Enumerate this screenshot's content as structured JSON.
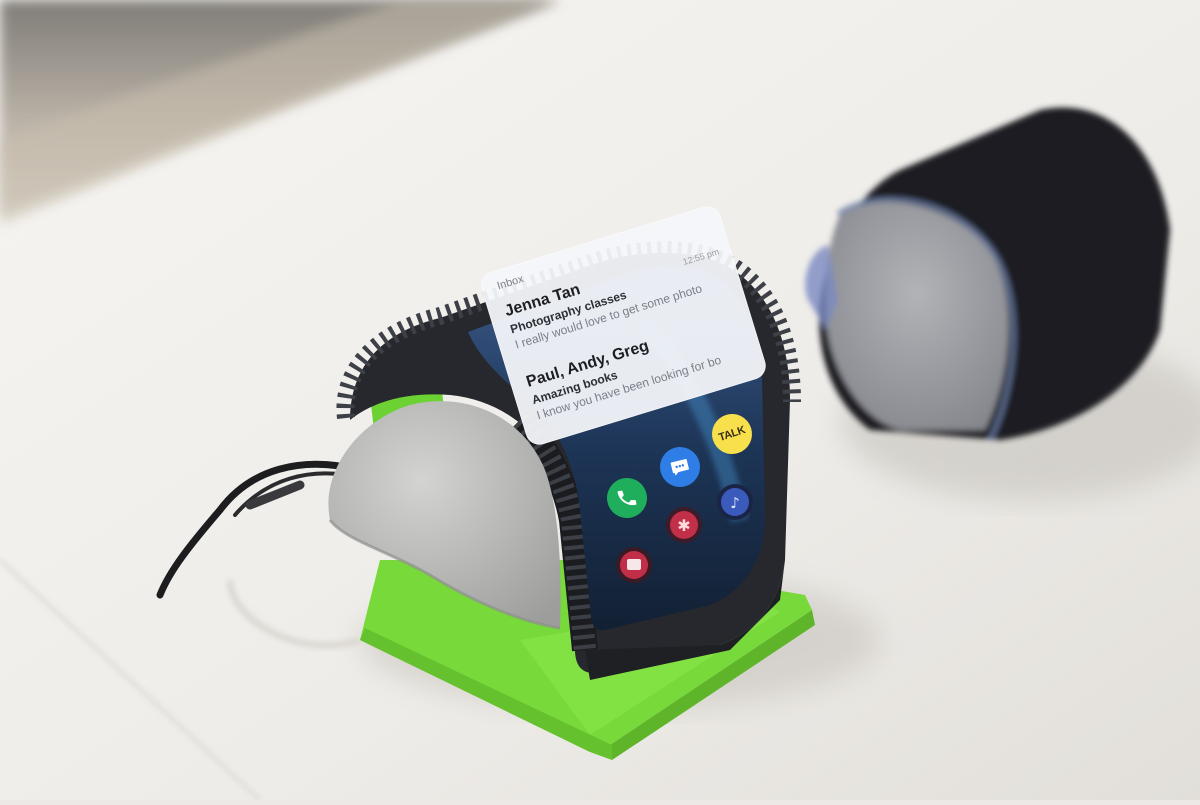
{
  "scene": {
    "description_colors": {
      "table": "#f3f1ee",
      "device_body": "#2a2c31",
      "stand": "#7ee23b",
      "cushion": "#b9bab9",
      "background_band": "#bfb8ae"
    }
  },
  "notification": {
    "inbox_label": "Inbox",
    "messages": [
      {
        "sender": "Jenna Tan",
        "subject": "Photography classes",
        "preview": "I really would love to get some photo",
        "timestamp": "12:55 pm"
      },
      {
        "sender": "Paul, Andy, Greg",
        "subject": "Amazing books",
        "preview": "I know you have been looking for bo"
      }
    ]
  },
  "apps": {
    "kakao_label": "TALK",
    "items": [
      {
        "name": "phone-icon",
        "color": "#1fae5b"
      },
      {
        "name": "messages-icon",
        "color": "#2f7de6"
      },
      {
        "name": "kakao-talk-icon",
        "color": "#f7e04b"
      },
      {
        "name": "camera-icon",
        "color": "#d7394a"
      },
      {
        "name": "gallery-icon",
        "color": "#d8324e"
      },
      {
        "name": "music-icon",
        "color": "#3f62c9"
      }
    ]
  }
}
